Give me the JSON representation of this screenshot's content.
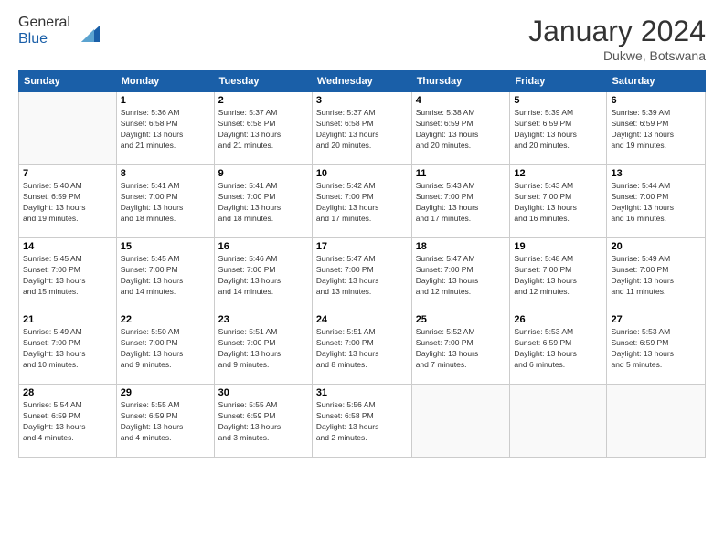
{
  "logo": {
    "general": "General",
    "blue": "Blue"
  },
  "title": "January 2024",
  "location": "Dukwe, Botswana",
  "days_of_week": [
    "Sunday",
    "Monday",
    "Tuesday",
    "Wednesday",
    "Thursday",
    "Friday",
    "Saturday"
  ],
  "weeks": [
    [
      {
        "day": "",
        "info": ""
      },
      {
        "day": "1",
        "info": "Sunrise: 5:36 AM\nSunset: 6:58 PM\nDaylight: 13 hours\nand 21 minutes."
      },
      {
        "day": "2",
        "info": "Sunrise: 5:37 AM\nSunset: 6:58 PM\nDaylight: 13 hours\nand 21 minutes."
      },
      {
        "day": "3",
        "info": "Sunrise: 5:37 AM\nSunset: 6:58 PM\nDaylight: 13 hours\nand 20 minutes."
      },
      {
        "day": "4",
        "info": "Sunrise: 5:38 AM\nSunset: 6:59 PM\nDaylight: 13 hours\nand 20 minutes."
      },
      {
        "day": "5",
        "info": "Sunrise: 5:39 AM\nSunset: 6:59 PM\nDaylight: 13 hours\nand 20 minutes."
      },
      {
        "day": "6",
        "info": "Sunrise: 5:39 AM\nSunset: 6:59 PM\nDaylight: 13 hours\nand 19 minutes."
      }
    ],
    [
      {
        "day": "7",
        "info": "Sunrise: 5:40 AM\nSunset: 6:59 PM\nDaylight: 13 hours\nand 19 minutes."
      },
      {
        "day": "8",
        "info": "Sunrise: 5:41 AM\nSunset: 7:00 PM\nDaylight: 13 hours\nand 18 minutes."
      },
      {
        "day": "9",
        "info": "Sunrise: 5:41 AM\nSunset: 7:00 PM\nDaylight: 13 hours\nand 18 minutes."
      },
      {
        "day": "10",
        "info": "Sunrise: 5:42 AM\nSunset: 7:00 PM\nDaylight: 13 hours\nand 17 minutes."
      },
      {
        "day": "11",
        "info": "Sunrise: 5:43 AM\nSunset: 7:00 PM\nDaylight: 13 hours\nand 17 minutes."
      },
      {
        "day": "12",
        "info": "Sunrise: 5:43 AM\nSunset: 7:00 PM\nDaylight: 13 hours\nand 16 minutes."
      },
      {
        "day": "13",
        "info": "Sunrise: 5:44 AM\nSunset: 7:00 PM\nDaylight: 13 hours\nand 16 minutes."
      }
    ],
    [
      {
        "day": "14",
        "info": "Sunrise: 5:45 AM\nSunset: 7:00 PM\nDaylight: 13 hours\nand 15 minutes."
      },
      {
        "day": "15",
        "info": "Sunrise: 5:45 AM\nSunset: 7:00 PM\nDaylight: 13 hours\nand 14 minutes."
      },
      {
        "day": "16",
        "info": "Sunrise: 5:46 AM\nSunset: 7:00 PM\nDaylight: 13 hours\nand 14 minutes."
      },
      {
        "day": "17",
        "info": "Sunrise: 5:47 AM\nSunset: 7:00 PM\nDaylight: 13 hours\nand 13 minutes."
      },
      {
        "day": "18",
        "info": "Sunrise: 5:47 AM\nSunset: 7:00 PM\nDaylight: 13 hours\nand 12 minutes."
      },
      {
        "day": "19",
        "info": "Sunrise: 5:48 AM\nSunset: 7:00 PM\nDaylight: 13 hours\nand 12 minutes."
      },
      {
        "day": "20",
        "info": "Sunrise: 5:49 AM\nSunset: 7:00 PM\nDaylight: 13 hours\nand 11 minutes."
      }
    ],
    [
      {
        "day": "21",
        "info": "Sunrise: 5:49 AM\nSunset: 7:00 PM\nDaylight: 13 hours\nand 10 minutes."
      },
      {
        "day": "22",
        "info": "Sunrise: 5:50 AM\nSunset: 7:00 PM\nDaylight: 13 hours\nand 9 minutes."
      },
      {
        "day": "23",
        "info": "Sunrise: 5:51 AM\nSunset: 7:00 PM\nDaylight: 13 hours\nand 9 minutes."
      },
      {
        "day": "24",
        "info": "Sunrise: 5:51 AM\nSunset: 7:00 PM\nDaylight: 13 hours\nand 8 minutes."
      },
      {
        "day": "25",
        "info": "Sunrise: 5:52 AM\nSunset: 7:00 PM\nDaylight: 13 hours\nand 7 minutes."
      },
      {
        "day": "26",
        "info": "Sunrise: 5:53 AM\nSunset: 6:59 PM\nDaylight: 13 hours\nand 6 minutes."
      },
      {
        "day": "27",
        "info": "Sunrise: 5:53 AM\nSunset: 6:59 PM\nDaylight: 13 hours\nand 5 minutes."
      }
    ],
    [
      {
        "day": "28",
        "info": "Sunrise: 5:54 AM\nSunset: 6:59 PM\nDaylight: 13 hours\nand 4 minutes."
      },
      {
        "day": "29",
        "info": "Sunrise: 5:55 AM\nSunset: 6:59 PM\nDaylight: 13 hours\nand 4 minutes."
      },
      {
        "day": "30",
        "info": "Sunrise: 5:55 AM\nSunset: 6:59 PM\nDaylight: 13 hours\nand 3 minutes."
      },
      {
        "day": "31",
        "info": "Sunrise: 5:56 AM\nSunset: 6:58 PM\nDaylight: 13 hours\nand 2 minutes."
      },
      {
        "day": "",
        "info": ""
      },
      {
        "day": "",
        "info": ""
      },
      {
        "day": "",
        "info": ""
      }
    ]
  ]
}
